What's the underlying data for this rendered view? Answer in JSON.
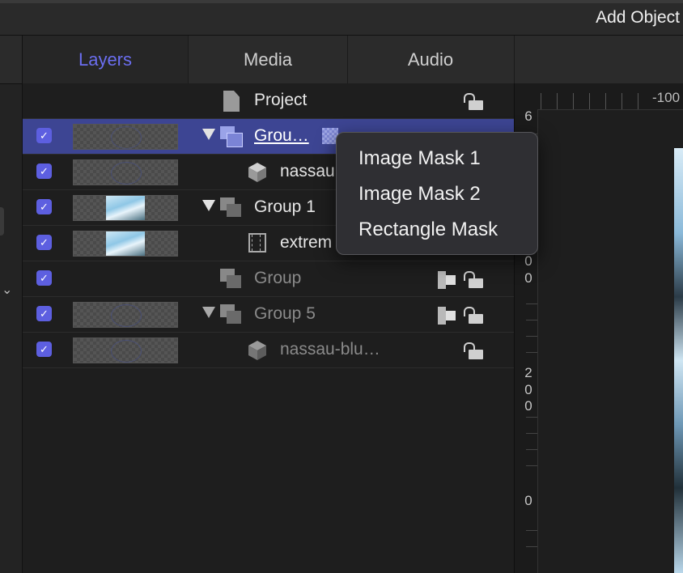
{
  "toolbar": {
    "add_object_label": "Add Object"
  },
  "tabs": [
    {
      "label": "Layers",
      "active": true
    },
    {
      "label": "Media",
      "active": false
    },
    {
      "label": "Audio",
      "active": false
    }
  ],
  "layers": [
    {
      "name": "Project",
      "type": "project",
      "checked": null
    },
    {
      "name": "Grou…",
      "type": "group",
      "checked": true,
      "selected": true
    },
    {
      "name": "nassau",
      "type": "object",
      "checked": true
    },
    {
      "name": "Group 1",
      "type": "group",
      "checked": true
    },
    {
      "name": "extrem",
      "type": "video",
      "checked": true
    },
    {
      "name": "Group",
      "type": "group",
      "checked": true,
      "dimmed": true
    },
    {
      "name": "Group 5",
      "type": "group",
      "checked": true,
      "dimmed": true
    },
    {
      "name": "nassau-blu…",
      "type": "object",
      "checked": true,
      "dimmed": true
    }
  ],
  "context_menu": {
    "items": [
      "Image Mask 1",
      "Image Mask 2",
      "Rectangle Mask"
    ]
  },
  "ruler": {
    "top_label": "-100",
    "left_digits": [
      "6",
      "0",
      "0",
      "2",
      "0",
      "0",
      "0"
    ]
  },
  "colors": {
    "accent": "#6b6ef0",
    "selection": "#3d4593",
    "checkbox": "#5d5fe0"
  }
}
